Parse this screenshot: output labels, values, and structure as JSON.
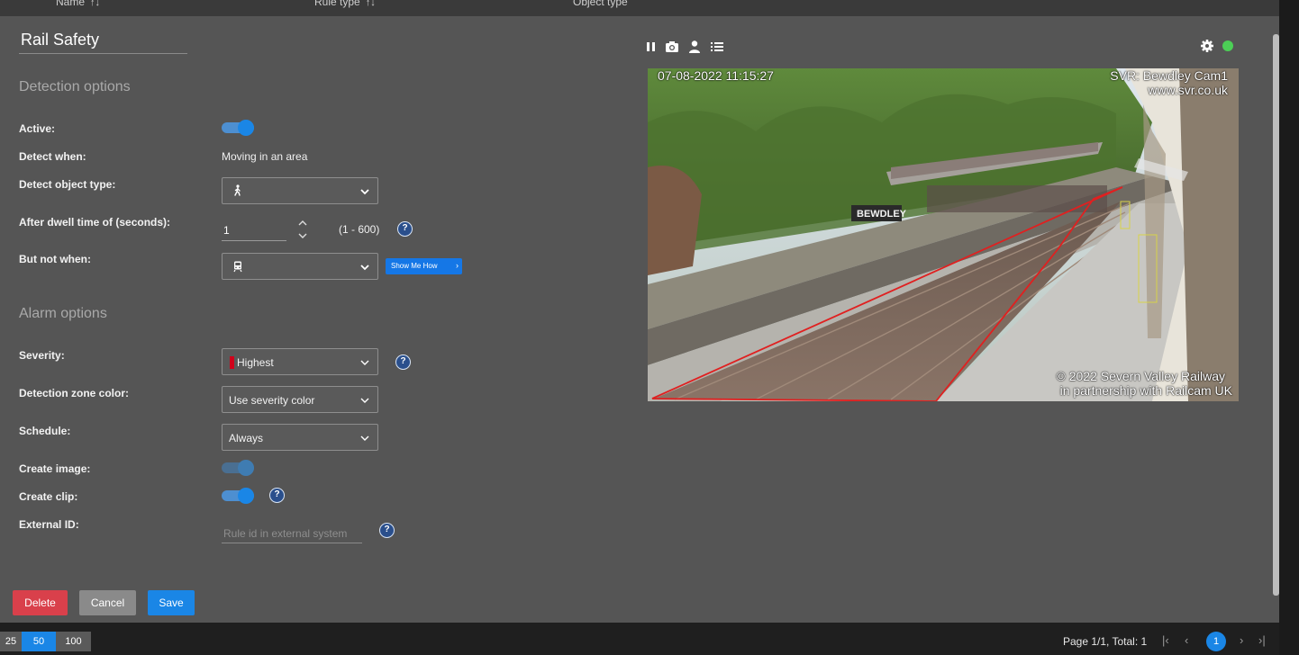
{
  "header": {
    "columns": [
      {
        "label": "Name",
        "sortable": true
      },
      {
        "label": "Rule type",
        "sortable": true
      },
      {
        "label": "Object type",
        "sortable": false
      }
    ],
    "sort_glyph": "↑↓"
  },
  "form": {
    "rule_name": "Rail Safety",
    "detection_section": "Detection options",
    "alarm_section": "Alarm options",
    "labels": {
      "active": "Active:",
      "detect_when": "Detect when:",
      "detect_object_type": "Detect object type:",
      "dwell_time": "After dwell time of (seconds):",
      "but_not_when": "But not when:",
      "severity": "Severity:",
      "zone_color": "Detection zone color:",
      "schedule": "Schedule:",
      "create_image": "Create image:",
      "create_clip": "Create clip:",
      "external_id": "External ID:"
    },
    "active": true,
    "detect_when_value": "Moving in an area",
    "object_type_icon": "person-walking-icon",
    "dwell_value": "1",
    "dwell_range": "(1 - 600)",
    "but_not_when_icon": "train-icon",
    "show_me_how": "Show Me How",
    "severity_value": "Highest",
    "severity_color": "#d0021b",
    "zone_color_value": "Use severity color",
    "schedule_value": "Always",
    "create_image": true,
    "create_image_disabled": true,
    "create_clip": true,
    "external_id_placeholder": "Rule id in external system",
    "help_glyph": "?"
  },
  "buttons": {
    "delete": "Delete",
    "cancel": "Cancel",
    "save": "Save"
  },
  "camera": {
    "timestamp": "07-08-2022 11:15:27",
    "camera_name": "SVR: Bewdley Cam1",
    "website": "www.svr.co.uk",
    "copyright_line1": "© 2022 Severn Valley Railway",
    "copyright_line2": "in partnership with Railcam UK",
    "station_sign": "BEWDLEY",
    "toolbar_icons": [
      "pause-icon",
      "camera-icon",
      "person-icon",
      "list-icon"
    ],
    "settings_icon": "gear-icon",
    "status_color": "#4ccf56"
  },
  "footer": {
    "page_sizes": [
      "25",
      "50",
      "100"
    ],
    "selected_page_size": "50",
    "page_info": "Page 1/1, Total: 1",
    "current_page": "1"
  },
  "colors": {
    "accent": "#1a86e6",
    "danger": "#d9404b",
    "panel": "#555555",
    "zone_line": "#e02020"
  }
}
